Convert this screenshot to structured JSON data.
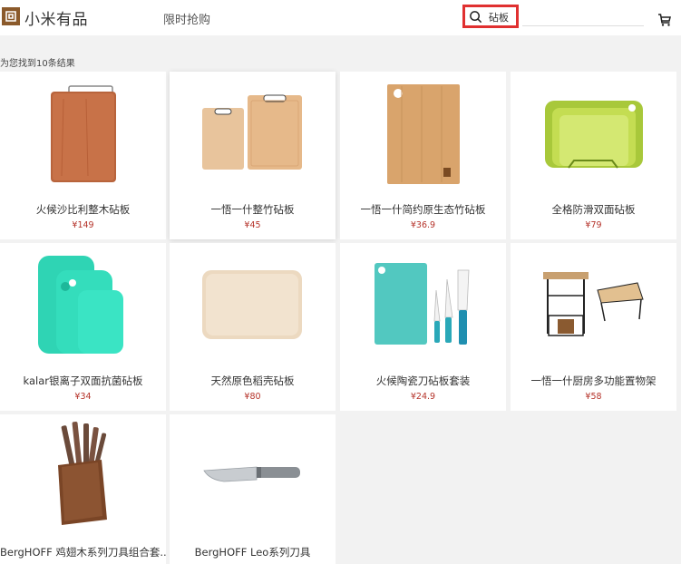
{
  "header": {
    "brand_name": "小米有品",
    "flash_sale_label": "限时抢购",
    "search_value": "砧板",
    "icons": [
      "logo-icon",
      "search-icon",
      "cart-icon"
    ]
  },
  "results": {
    "count_text": "为您找到10条结果"
  },
  "products": [
    {
      "name": "火候沙比利整木砧板",
      "price": "¥149"
    },
    {
      "name": "一悟一什整竹砧板",
      "price": "¥45"
    },
    {
      "name": "一悟一什简约原生态竹砧板",
      "price": "¥36.9"
    },
    {
      "name": "全格防滑双面砧板",
      "price": "¥79"
    },
    {
      "name": "kalar银离子双面抗菌砧板",
      "price": "¥34"
    },
    {
      "name": "天然原色稻壳砧板",
      "price": "¥80"
    },
    {
      "name": "火候陶瓷刀砧板套装",
      "price": "¥24.9"
    },
    {
      "name": "一悟一什厨房多功能置物架",
      "price": "¥58"
    },
    {
      "name": "BergHOFF 鸡翅木系列刀具组合套...",
      "price": ""
    },
    {
      "name": "BergHOFF Leo系列刀具",
      "price": ""
    }
  ],
  "colors": {
    "brand": "#8b5a2b",
    "price": "#b5332a",
    "search_highlight": "#e03030"
  }
}
